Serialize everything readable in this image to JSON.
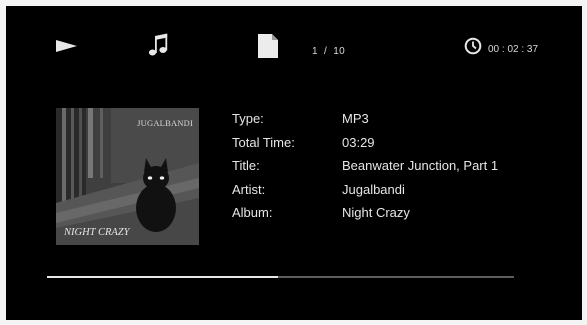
{
  "header": {
    "track_counter": "1  /  10",
    "elapsed_time": "00 : 02 : 37",
    "icons": [
      "play-icon",
      "music-note-icon",
      "file-icon",
      "clock-icon"
    ]
  },
  "album_art": {
    "band_text": "JUGALBANDI",
    "album_text": "NIGHT CRAZY"
  },
  "info": {
    "rows": [
      {
        "label": "Type:",
        "value": "MP3"
      },
      {
        "label": "Total Time:",
        "value": "03:29"
      },
      {
        "label": "Title:",
        "value": "Beanwater Junction, Part 1"
      },
      {
        "label": "Artist:",
        "value": "Jugalbandi"
      },
      {
        "label": "Album:",
        "value": "Night Crazy"
      }
    ]
  },
  "progress": {
    "fraction": 0.495
  },
  "colors": {
    "background": "#000000",
    "text": "#e6e6e6",
    "progress_fill": "#e8e8e8",
    "progress_track": "#5e5e5e"
  }
}
